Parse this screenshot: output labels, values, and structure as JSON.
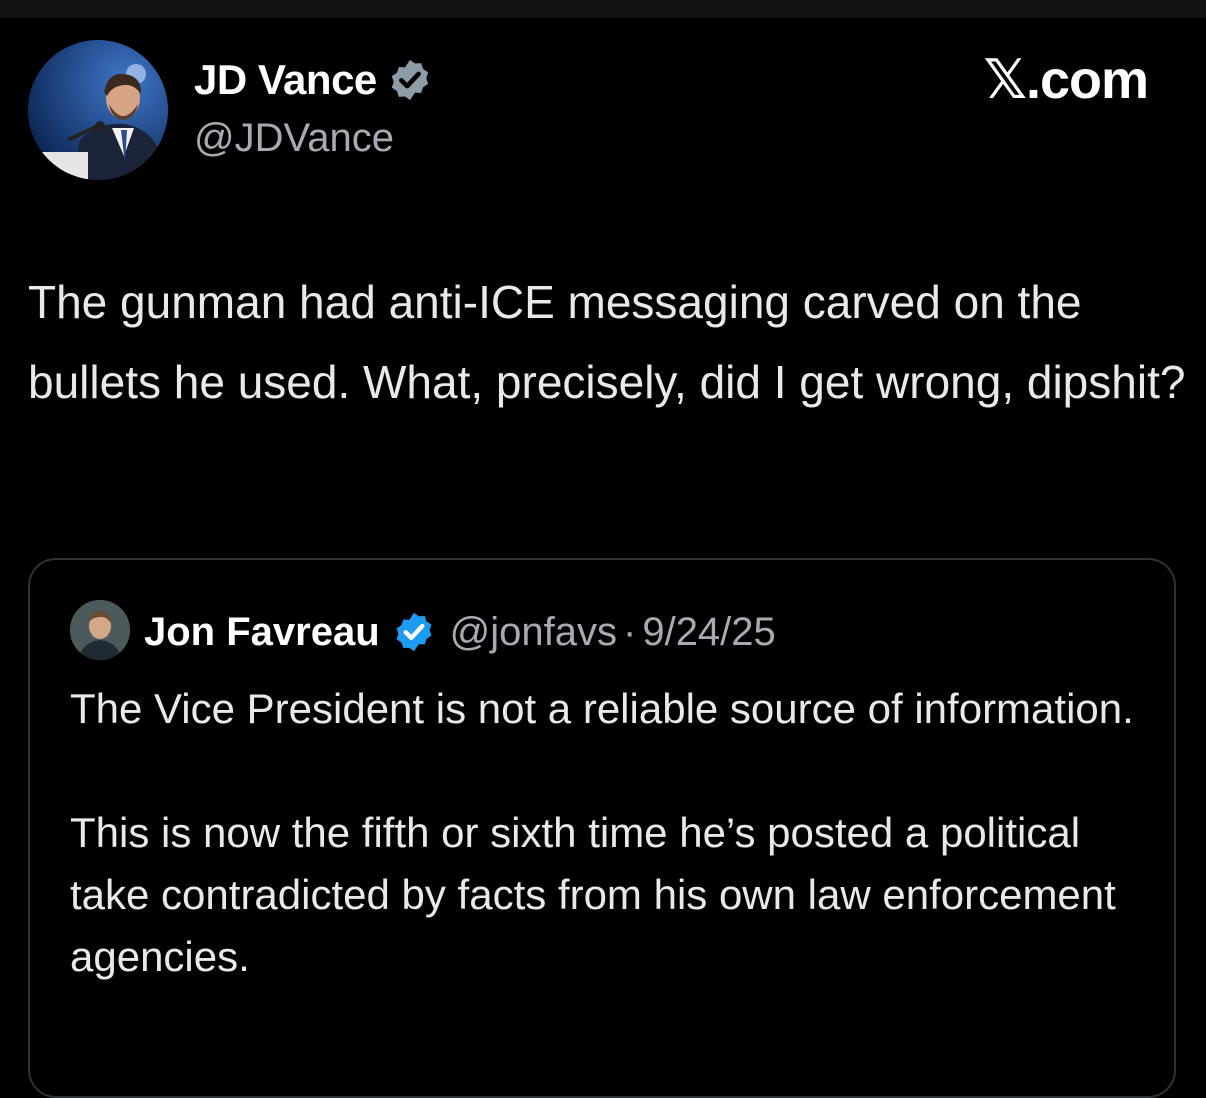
{
  "post": {
    "author": {
      "display_name": "JD Vance",
      "handle": "@JDVance",
      "verified_badge": "verified-badge-icon",
      "badge_color": "#8e9ca8"
    },
    "brand": "𝕏.com",
    "text": "The gunman had anti-ICE messaging carved on the bullets he used. What, precisely, did I get wrong, dipshit?"
  },
  "quoted_post": {
    "author": {
      "display_name": "Jon Favreau",
      "handle": "@jonfavs",
      "verified_badge": "verified-badge-icon",
      "badge_color": "#1d9bf0"
    },
    "separator": "·",
    "date": "9/24/25",
    "paragraphs": [
      "The Vice President is not a reliable source of information.",
      "This is now the fifth or sixth time he’s posted a political take contradicted by facts from his own law enforcement agencies."
    ]
  },
  "colors": {
    "background": "#000000",
    "text": "#e7e9ea",
    "secondary_text": "#a5abb1",
    "border": "#2f3336"
  }
}
